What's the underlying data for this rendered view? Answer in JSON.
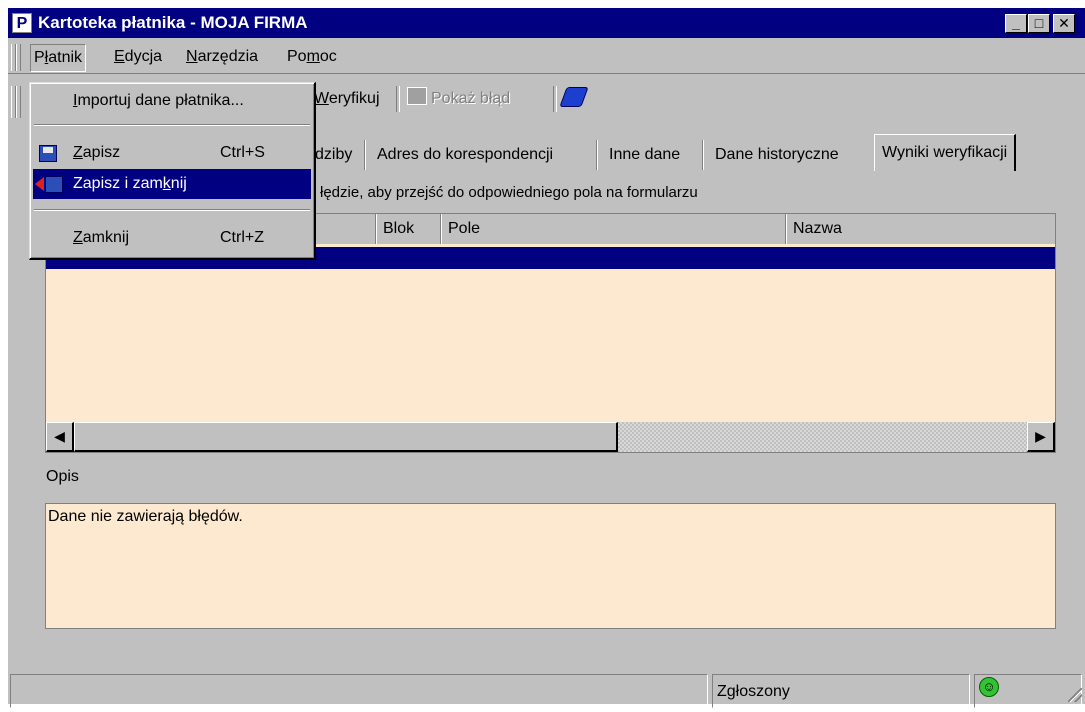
{
  "window": {
    "title": "Kartoteka płatnika - MOJA FIRMA",
    "icon_letter": "P",
    "controls": [
      "minimize-icon",
      "maximize-icon",
      "close-icon"
    ]
  },
  "menubar": {
    "items": [
      {
        "pre": "P",
        "ul": "ł",
        "post": "atnik"
      },
      {
        "pre": "",
        "ul": "E",
        "post": "dycja"
      },
      {
        "pre": "",
        "ul": "N",
        "post": "arzędzia"
      },
      {
        "pre": "Po",
        "ul": "m",
        "post": "oc"
      }
    ]
  },
  "toolbar": {
    "verify_label_ul": "W",
    "verify_label_rest": "eryfikuj",
    "show_error_label": "Pokaż błąd",
    "help_icon": "book-icon"
  },
  "tabs": {
    "items": [
      "dziby",
      "Adres do korespondencji",
      "Inne dane",
      "Dane historyczne",
      "Wyniki weryfikacji"
    ],
    "selected": "Wyniki weryfikacji"
  },
  "results": {
    "hint": "łędzie, aby przejść do odpowiedniego pola na formularzu",
    "columns": [
      "Blok",
      "Pole",
      "Nazwa"
    ]
  },
  "description": {
    "label": "Opis",
    "text": "Dane nie zawierają błędów."
  },
  "statusbar": {
    "status": "Zgłoszony",
    "status_icon": "smiley-icon"
  },
  "dropdown": {
    "import": {
      "pre": "",
      "ul": "I",
      "post": "mportuj dane płatnika..."
    },
    "save": {
      "pre": "",
      "ul": "Z",
      "post": "apisz",
      "shortcut": "Ctrl+S"
    },
    "save_close": {
      "pre": "Zapisz i zam",
      "ul": "k",
      "post": "nij"
    },
    "close": {
      "pre": "",
      "ul": "Z",
      "post": "amknij",
      "shortcut": "Ctrl+Z"
    }
  },
  "colors": {
    "titlebar": "#000080",
    "face": "#c0c0c0",
    "field_background": "#fde9cf",
    "selection": "#000080"
  }
}
